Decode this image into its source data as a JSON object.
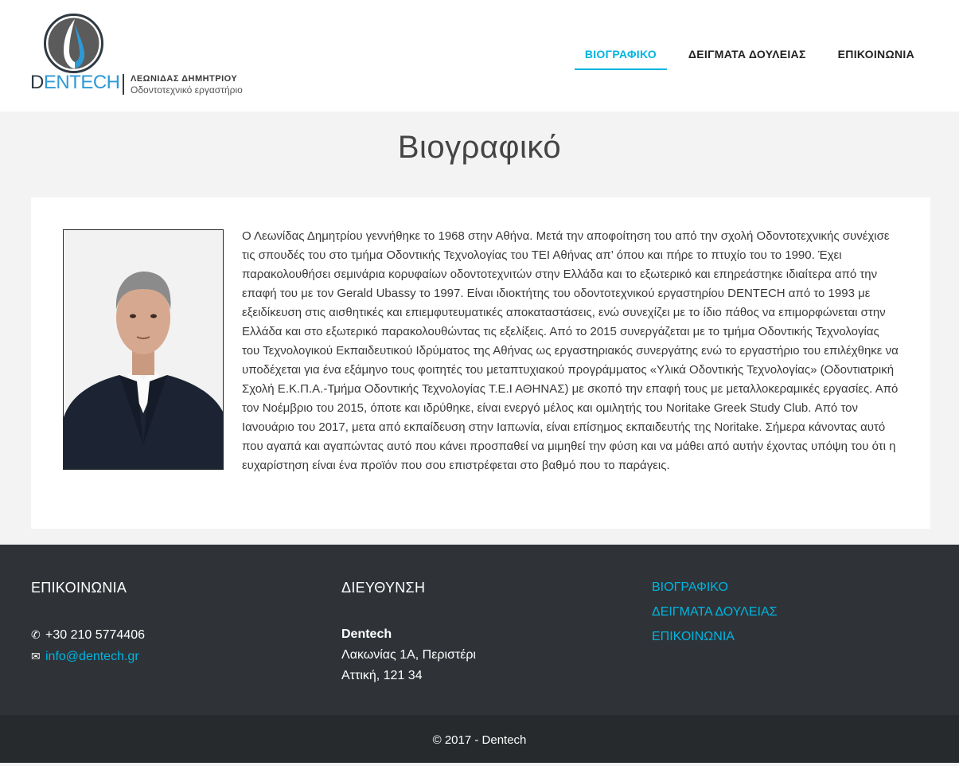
{
  "header": {
    "logo": {
      "wordmark_d": "D",
      "wordmark_rest": "ENTECH",
      "name": "ΛΕΩΝΙΔΑΣ ΔΗΜΗΤΡΙΟΥ",
      "subtitle": "Οδοντοτεχνικό εργαστήριο"
    },
    "nav": [
      {
        "label": "ΒΙΟΓΡΑΦΙΚΟ",
        "active": true
      },
      {
        "label": "ΔΕΙΓΜΑΤΑ ΔΟΥΛΕΙΑΣ",
        "active": false
      },
      {
        "label": "ΕΠΙΚΟΙΝΩΝΙΑ",
        "active": false
      }
    ]
  },
  "main": {
    "title": "Βιογραφικό",
    "bio": "Ο Λεωνίδας Δημητρίου γεννήθηκε το 1968 στην Αθήνα. Μετά την αποφοίτηση του από την σχολή Οδοντοτεχνικής συνέχισε τις σπουδές του στο τμήμα Οδοντικής Τεχνολογίας του ΤΕΙ Αθήνας απ’ όπου και πήρε το πτυχίο του το 1990. Έχει παρακολουθήσει σεμινάρια κορυφαίων οδοντοτεχνιτών στην Ελλάδα και το εξωτερικό και επηρεάστηκε ιδιαίτερα από την επαφή του με τον Gerald Ubassy το 1997. Είναι ιδιοκτήτης του οδοντοτεχνικού εργαστηρίου DENTECH από το 1993 με εξειδίκευση στις αισθητικές και επιεμφυτευματικές αποκαταστάσεις, ενώ συνεχίζει με το ίδιο πάθος να επιμορφώνεται στην Ελλάδα και στο εξωτερικό παρακολουθώντας τις εξελίξεις. Από το 2015 συνεργάζεται με το τμήμα Οδοντικής Τεχνολογίας του Τεχνολογικού Εκπαιδευτικού Ιδρύματος της Αθήνας ως εργαστηριακός συνεργάτης ενώ το εργαστήριο του επιλέχθηκε να υποδέχεται για ένα εξάμηνο τους φοιτητές του μεταπτυχιακού προγράμματος «Υλικά Οδοντικής Τεχνολογίας» (Οδοντιατρική Σχολή Ε.Κ.Π.Α.-Τμήμα Οδοντικής Τεχνολογίας Τ.Ε.Ι ΑΘΗΝΑΣ) με σκοπό την επαφή τους με μεταλλοκεραμικές εργασίες. Από τον Νοέμβριο του 2015, όποτε και ιδρύθηκε, είναι ενεργό μέλος και ομιλητής του Noritake Greek Study Club. Από τον Ιανουάριο του 2017, μετα από εκπαίδευση στην Ιαπωνία, είναι επίσημος εκπαιδευτής της Noritake. Σήμερα κάνοντας αυτό που αγαπά και αγαπώντας αυτό που κάνει προσπαθεί να μιμηθεί την φύση και να μάθει από αυτήν έχοντας υπόψη του ότι η ευχαρίστηση είναι ένα προϊόν που σου επιστρέφεται στο βαθμό που το παράγεις."
  },
  "footer": {
    "contact": {
      "heading": "ΕΠΙΚΟΙΝΩΝΙΑ",
      "phone_icon": "phone-icon",
      "phone": "+30 210 5774406",
      "email_icon": "envelope-icon",
      "email": "info@dentech.gr"
    },
    "address": {
      "heading": "ΔΙΕΥΘΥΝΣΗ",
      "company": "Dentech",
      "street": "Λακωνίας 1Α, Περιστέρι",
      "city": "Αττική, 121 34"
    },
    "links": [
      "ΒΙΟΓΡΑΦΙΚΟ",
      "ΔΕΙΓΜΑΤΑ ΔΟΥΛΕΙΑΣ",
      "ΕΠΙΚΟΙΝΩΝΙΑ"
    ],
    "copyright": "© 2017 - Dentech"
  },
  "colors": {
    "accent": "#00b4e0",
    "footer_bg": "#2f3337",
    "copyright_bg": "#262a2d",
    "page_bg": "#f3f3f3"
  }
}
